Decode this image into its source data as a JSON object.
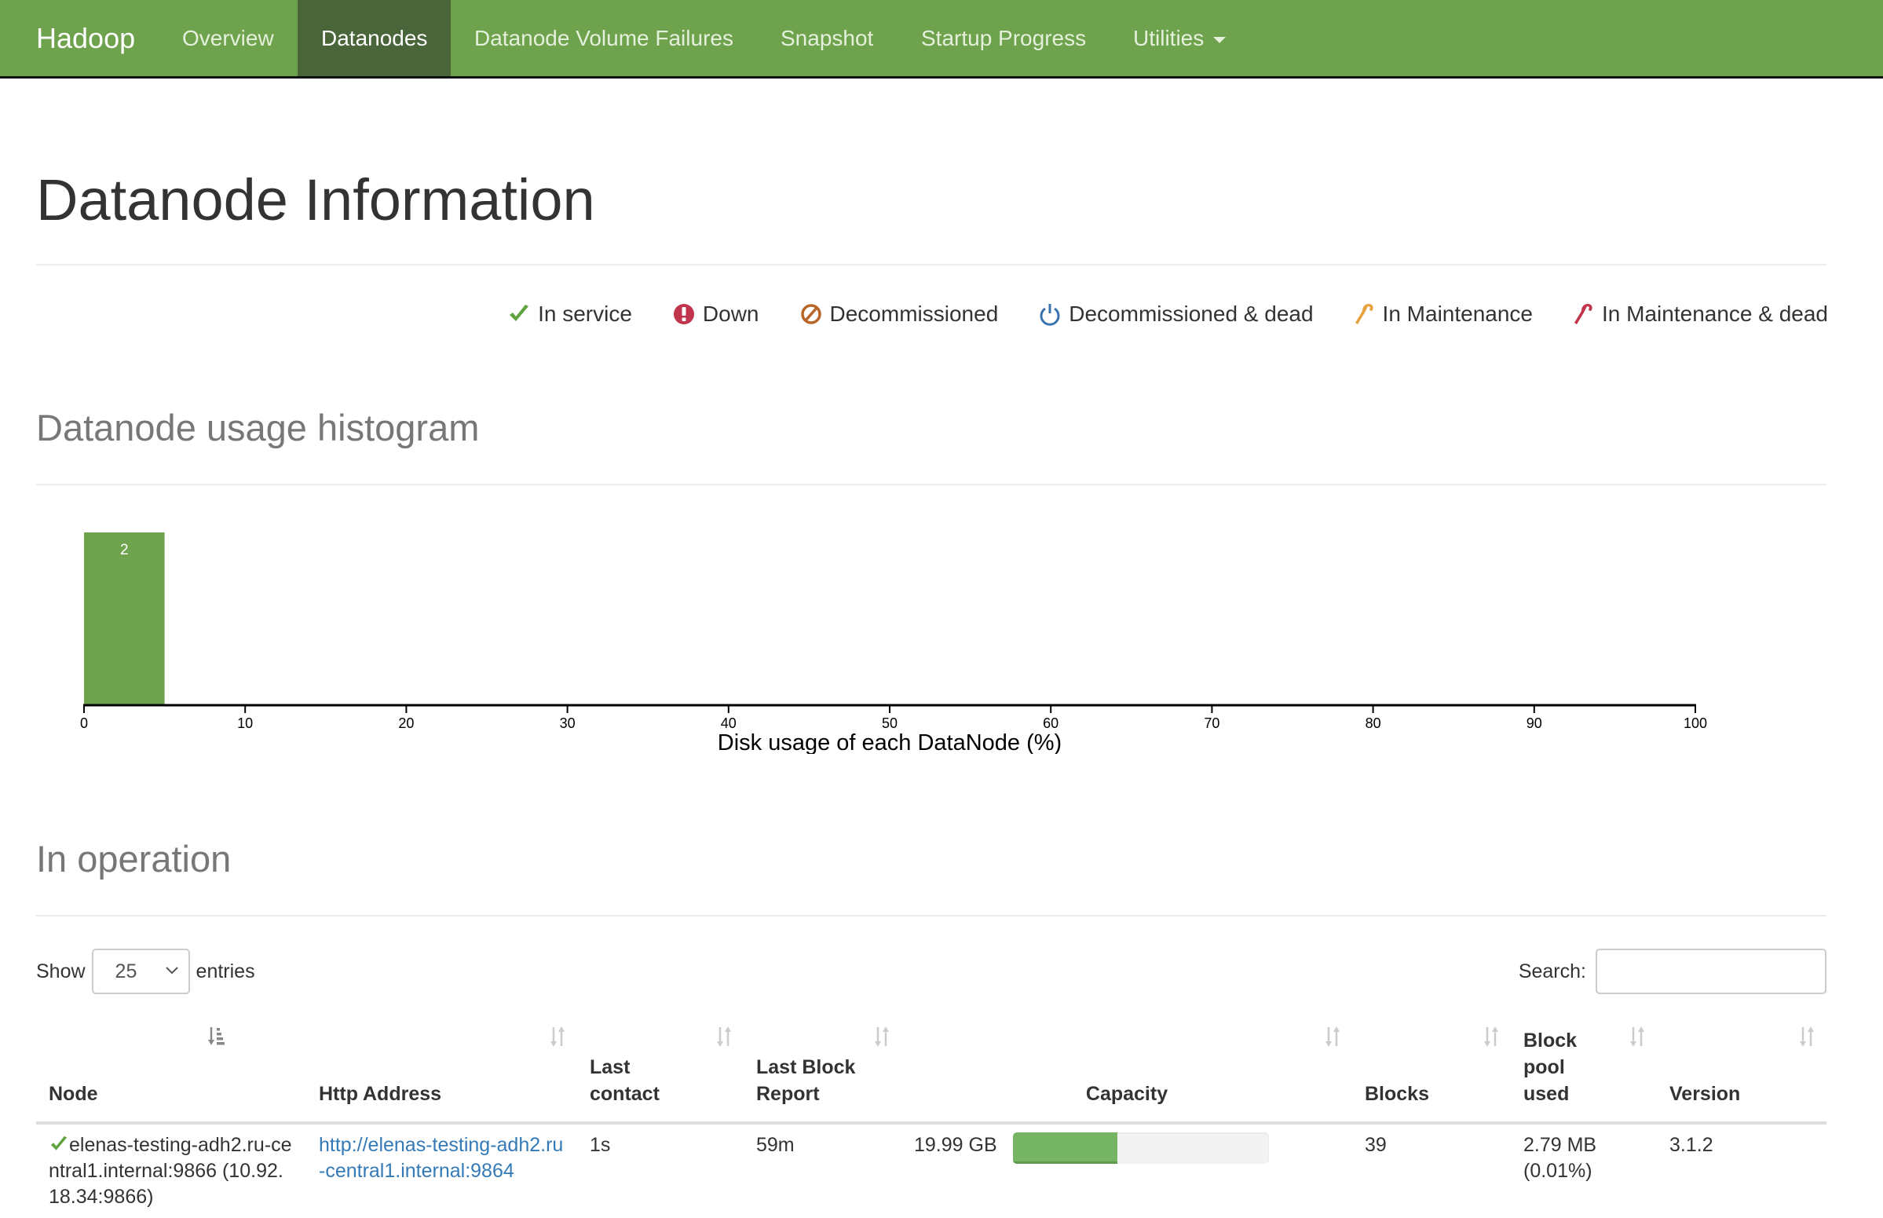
{
  "navbar": {
    "brand": "Hadoop",
    "items": [
      {
        "label": "Overview",
        "active": false
      },
      {
        "label": "Datanodes",
        "active": true
      },
      {
        "label": "Datanode Volume Failures",
        "active": false
      },
      {
        "label": "Snapshot",
        "active": false
      },
      {
        "label": "Startup Progress",
        "active": false
      },
      {
        "label": "Utilities",
        "active": false,
        "dropdown": true
      }
    ]
  },
  "page": {
    "title": "Datanode Information"
  },
  "legend": [
    {
      "icon": "check-icon",
      "label": "In service",
      "color": "#5fa341"
    },
    {
      "icon": "exclamation-circle-icon",
      "label": "Down",
      "color": "#c0354d"
    },
    {
      "icon": "ban-icon",
      "label": "Decommissioned",
      "color": "#b8662a"
    },
    {
      "icon": "power-icon",
      "label": "Decommissioned & dead",
      "color": "#3a72b0"
    },
    {
      "icon": "wrench-icon",
      "label": "In Maintenance",
      "color": "#e8a13f"
    },
    {
      "icon": "wrench-icon",
      "label": "In Maintenance & dead",
      "color": "#c0354d"
    }
  ],
  "histogram_section": {
    "title": "Datanode usage histogram"
  },
  "chart_data": {
    "type": "bar",
    "title": "Datanode usage histogram",
    "xlabel": "Disk usage of each DataNode (%)",
    "ylabel": "",
    "xlim": [
      0,
      100
    ],
    "x_ticks": [
      0,
      10,
      20,
      30,
      40,
      50,
      60,
      70,
      80,
      90,
      100
    ],
    "bins": [
      {
        "x0": 0,
        "x1": 5,
        "count": 2
      }
    ],
    "bar_color": "#6fa24c",
    "grid": false,
    "legend": "none"
  },
  "operation_section": {
    "title": "In operation",
    "show_label": "Show",
    "entries_label": "entries",
    "page_length": "25",
    "search_label": "Search:",
    "search_value": ""
  },
  "table": {
    "columns": [
      {
        "label": "Node",
        "sort": "sorted-asc"
      },
      {
        "label": "Http Address",
        "sort": "sortable"
      },
      {
        "label": "Last contact",
        "sort": "sortable"
      },
      {
        "label": "Last Block Report",
        "sort": "sortable"
      },
      {
        "label": "Capacity",
        "sort": "sortable"
      },
      {
        "label": "Blocks",
        "sort": "sortable"
      },
      {
        "label": "Block pool used",
        "sort": "sortable"
      },
      {
        "label": "Version",
        "sort": "sortable"
      }
    ],
    "rows": [
      {
        "status": "In service",
        "node": "elenas-testing-adh2.ru-central1.internal:9866 (10.92.18.34:9866)",
        "http_address": "http://elenas-testing-adh2.ru-central1.internal:9864",
        "last_contact": "1s",
        "last_block_report": "59m",
        "capacity": "19.99 GB",
        "capacity_used_percent": 41,
        "blocks": "39",
        "block_pool_used": "2.79 MB (0.01%)",
        "version": "3.1.2"
      }
    ]
  }
}
